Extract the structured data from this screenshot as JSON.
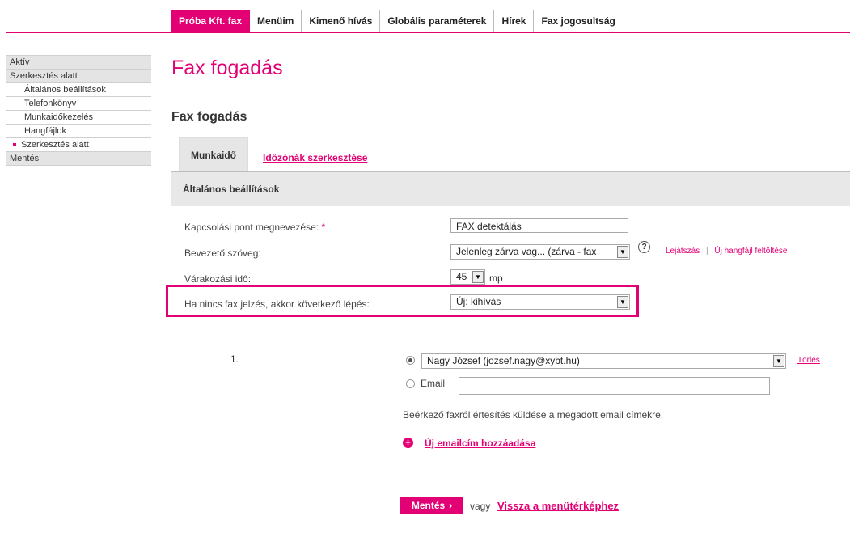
{
  "topnav": {
    "items": [
      {
        "label": "Próba Kft. fax",
        "active": true
      },
      {
        "label": "Menüim"
      },
      {
        "label": "Kimenő hívás"
      },
      {
        "label": "Globális paraméterek"
      },
      {
        "label": "Hírek"
      },
      {
        "label": "Fax jogosultság"
      }
    ]
  },
  "sidebar": {
    "items": [
      {
        "label": "Aktív"
      },
      {
        "label": "Szerkesztés alatt"
      },
      {
        "label": "Általános beállítások"
      },
      {
        "label": "Telefonkönyv"
      },
      {
        "label": "Munkaidőkezelés"
      },
      {
        "label": "Hangfájlok"
      },
      {
        "label": "Szerkesztés alatt"
      },
      {
        "label": "Mentés"
      }
    ]
  },
  "page": {
    "title": "Fax fogadás",
    "section_title": "Fax fogadás"
  },
  "tabs": {
    "active": "Munkaidő",
    "link": "Időzónák szerkesztése"
  },
  "panel": {
    "heading": "Általános beállítások"
  },
  "form": {
    "name_label": "Kapcsolási pont megnevezése:",
    "required_mark": "*",
    "name_value": "FAX detektálás",
    "intro_label": "Bevezető szöveg:",
    "intro_value": "Jelenleg zárva vag... (zárva - fax",
    "help_icon": "?",
    "play_link": "Lejátszás",
    "link_sep": "|",
    "upload_link": "Új hangfájl feltöltése",
    "wait_label": "Várakozási idő:",
    "wait_value": "45",
    "wait_unit": "mp",
    "next_label": "Ha nincs fax jelzés, akkor következő lépés:",
    "next_value": "Új: kihívás"
  },
  "recipient": {
    "index": "1.",
    "contact_value": "Nagy József (jozsef.nagy@xybt.hu)",
    "delete_link": "Törlés",
    "email_label": "Email",
    "email_value": "",
    "info_text": "Beérkező faxról értesítés küldése a megadott email címekre.",
    "add_link": "Új emailcím hozzáadása"
  },
  "footer": {
    "save_label": "Mentés",
    "or_text": "vagy",
    "back_link": "Vissza a menütérképhez"
  },
  "colors": {
    "accent": "#e20074"
  }
}
